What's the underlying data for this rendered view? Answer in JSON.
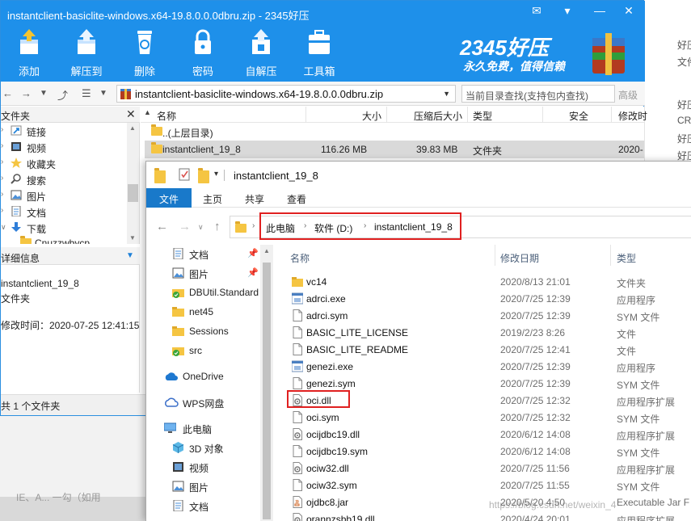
{
  "background_right": {
    "lines": [
      "好压",
      "文件",
      "好压",
      "CR",
      "好压",
      "好压"
    ]
  },
  "background_bottom": {
    "text": "IE、A... 一勾（如用"
  },
  "zip_window": {
    "title": "instantclient-basiclite-windows.x64-19.8.0.0.0dbru.zip - 2345好压",
    "toolbar": [
      {
        "label": "添加",
        "icon": "add-archive-icon"
      },
      {
        "label": "解压到",
        "icon": "extract-to-icon"
      },
      {
        "label": "删除",
        "icon": "recycle-bin-icon"
      },
      {
        "label": "密码",
        "icon": "lock-icon"
      },
      {
        "label": "自解压",
        "icon": "self-extract-icon"
      },
      {
        "label": "工具箱",
        "icon": "toolbox-icon"
      }
    ],
    "brand": {
      "name": "2345好压",
      "slogan": "永久免费，值得信赖"
    },
    "address": "instantclient-basiclite-windows.x64-19.8.0.0.0dbru.zip",
    "search_placeholder": "当前目录查找(支持包内查找)",
    "advanced_label": "高级",
    "tree_header": "文件夹",
    "tree_items": [
      {
        "label": "链接",
        "icon": "link-icon"
      },
      {
        "label": "视频",
        "icon": "video-icon"
      },
      {
        "label": "收藏夹",
        "icon": "star-icon"
      },
      {
        "label": "搜索",
        "icon": "search-icon"
      },
      {
        "label": "图片",
        "icon": "picture-icon"
      },
      {
        "label": "文档",
        "icon": "document-icon"
      },
      {
        "label": "下载",
        "icon": "download-icon"
      },
      {
        "label": "Cnuzzwbycp",
        "icon": "folder-icon"
      }
    ],
    "detail_header": "详细信息",
    "detail": {
      "name": "instantclient_19_8",
      "type": "文件夹",
      "modified": "修改时间：2020-07-25 12:41:15"
    },
    "status": "共 1 个文件夹",
    "columns": [
      "名称",
      "大小",
      "压缩后大小",
      "类型",
      "安全",
      "修改时"
    ],
    "rows": [
      {
        "name": "..(上层目录)",
        "size": "",
        "packed": "",
        "type": "",
        "modified": ""
      },
      {
        "name": "instantclient_19_8",
        "size": "116.26 MB",
        "packed": "39.83 MB",
        "type": "文件夹",
        "modified": "2020-"
      }
    ]
  },
  "explorer": {
    "title": "instantclient_19_8",
    "ribbon_tabs": [
      "文件",
      "主页",
      "共享",
      "查看"
    ],
    "breadcrumb": [
      "此电脑",
      "软件 (D:)",
      "instantclient_19_8"
    ],
    "nav": [
      {
        "label": "文档",
        "icon": "document-icon",
        "pinned": true
      },
      {
        "label": "图片",
        "icon": "picture-icon",
        "pinned": true
      },
      {
        "label": "DBUtil.Standard",
        "icon": "folder-sync-icon",
        "pinned": false
      },
      {
        "label": "net45",
        "icon": "folder-icon",
        "pinned": false
      },
      {
        "label": "Sessions",
        "icon": "folder-icon",
        "pinned": false
      },
      {
        "label": "src",
        "icon": "folder-sync-icon",
        "pinned": false
      },
      {
        "label": "OneDrive",
        "icon": "cloud-icon",
        "pinned": false
      },
      {
        "label": "WPS网盘",
        "icon": "wps-cloud-icon",
        "pinned": false
      },
      {
        "label": "此电脑",
        "icon": "computer-icon",
        "pinned": false
      },
      {
        "label": "3D 对象",
        "icon": "cube-icon",
        "pinned": false
      },
      {
        "label": "视频",
        "icon": "video-icon",
        "pinned": false
      },
      {
        "label": "图片",
        "icon": "picture-icon",
        "pinned": false
      },
      {
        "label": "文档",
        "icon": "document-icon",
        "pinned": false
      }
    ],
    "columns": [
      "名称",
      "修改日期",
      "类型"
    ],
    "files": [
      {
        "name": "vc14",
        "date": "2020/8/13 21:01",
        "type": "文件夹",
        "icon": "folder-icon"
      },
      {
        "name": "adrci.exe",
        "date": "2020/7/25 12:39",
        "type": "应用程序",
        "icon": "exe-icon"
      },
      {
        "name": "adrci.sym",
        "date": "2020/7/25 12:39",
        "type": "SYM 文件",
        "icon": "file-icon"
      },
      {
        "name": "BASIC_LITE_LICENSE",
        "date": "2019/2/23 8:26",
        "type": "文件",
        "icon": "file-icon"
      },
      {
        "name": "BASIC_LITE_README",
        "date": "2020/7/25 12:41",
        "type": "文件",
        "icon": "file-icon"
      },
      {
        "name": "genezi.exe",
        "date": "2020/7/25 12:39",
        "type": "应用程序",
        "icon": "exe-icon"
      },
      {
        "name": "genezi.sym",
        "date": "2020/7/25 12:39",
        "type": "SYM 文件",
        "icon": "file-icon"
      },
      {
        "name": "oci.dll",
        "date": "2020/7/25 12:32",
        "type": "应用程序扩展",
        "icon": "dll-icon"
      },
      {
        "name": "oci.sym",
        "date": "2020/7/25 12:32",
        "type": "SYM 文件",
        "icon": "file-icon"
      },
      {
        "name": "ocijdbc19.dll",
        "date": "2020/6/12 14:08",
        "type": "应用程序扩展",
        "icon": "dll-icon"
      },
      {
        "name": "ocijdbc19.sym",
        "date": "2020/6/12 14:08",
        "type": "SYM 文件",
        "icon": "file-icon"
      },
      {
        "name": "ociw32.dll",
        "date": "2020/7/25 11:56",
        "type": "应用程序扩展",
        "icon": "dll-icon"
      },
      {
        "name": "ociw32.sym",
        "date": "2020/7/25 11:55",
        "type": "SYM 文件",
        "icon": "file-icon"
      },
      {
        "name": "ojdbc8.jar",
        "date": "2020/5/20 4:50",
        "type": "Executable Jar F",
        "icon": "jar-icon"
      },
      {
        "name": "orannzsbb19.dll",
        "date": "2020/4/24 20:01",
        "type": "应用程序扩展",
        "icon": "dll-icon"
      }
    ]
  },
  "watermark": "https://blog.csdn.net/weixin_4"
}
